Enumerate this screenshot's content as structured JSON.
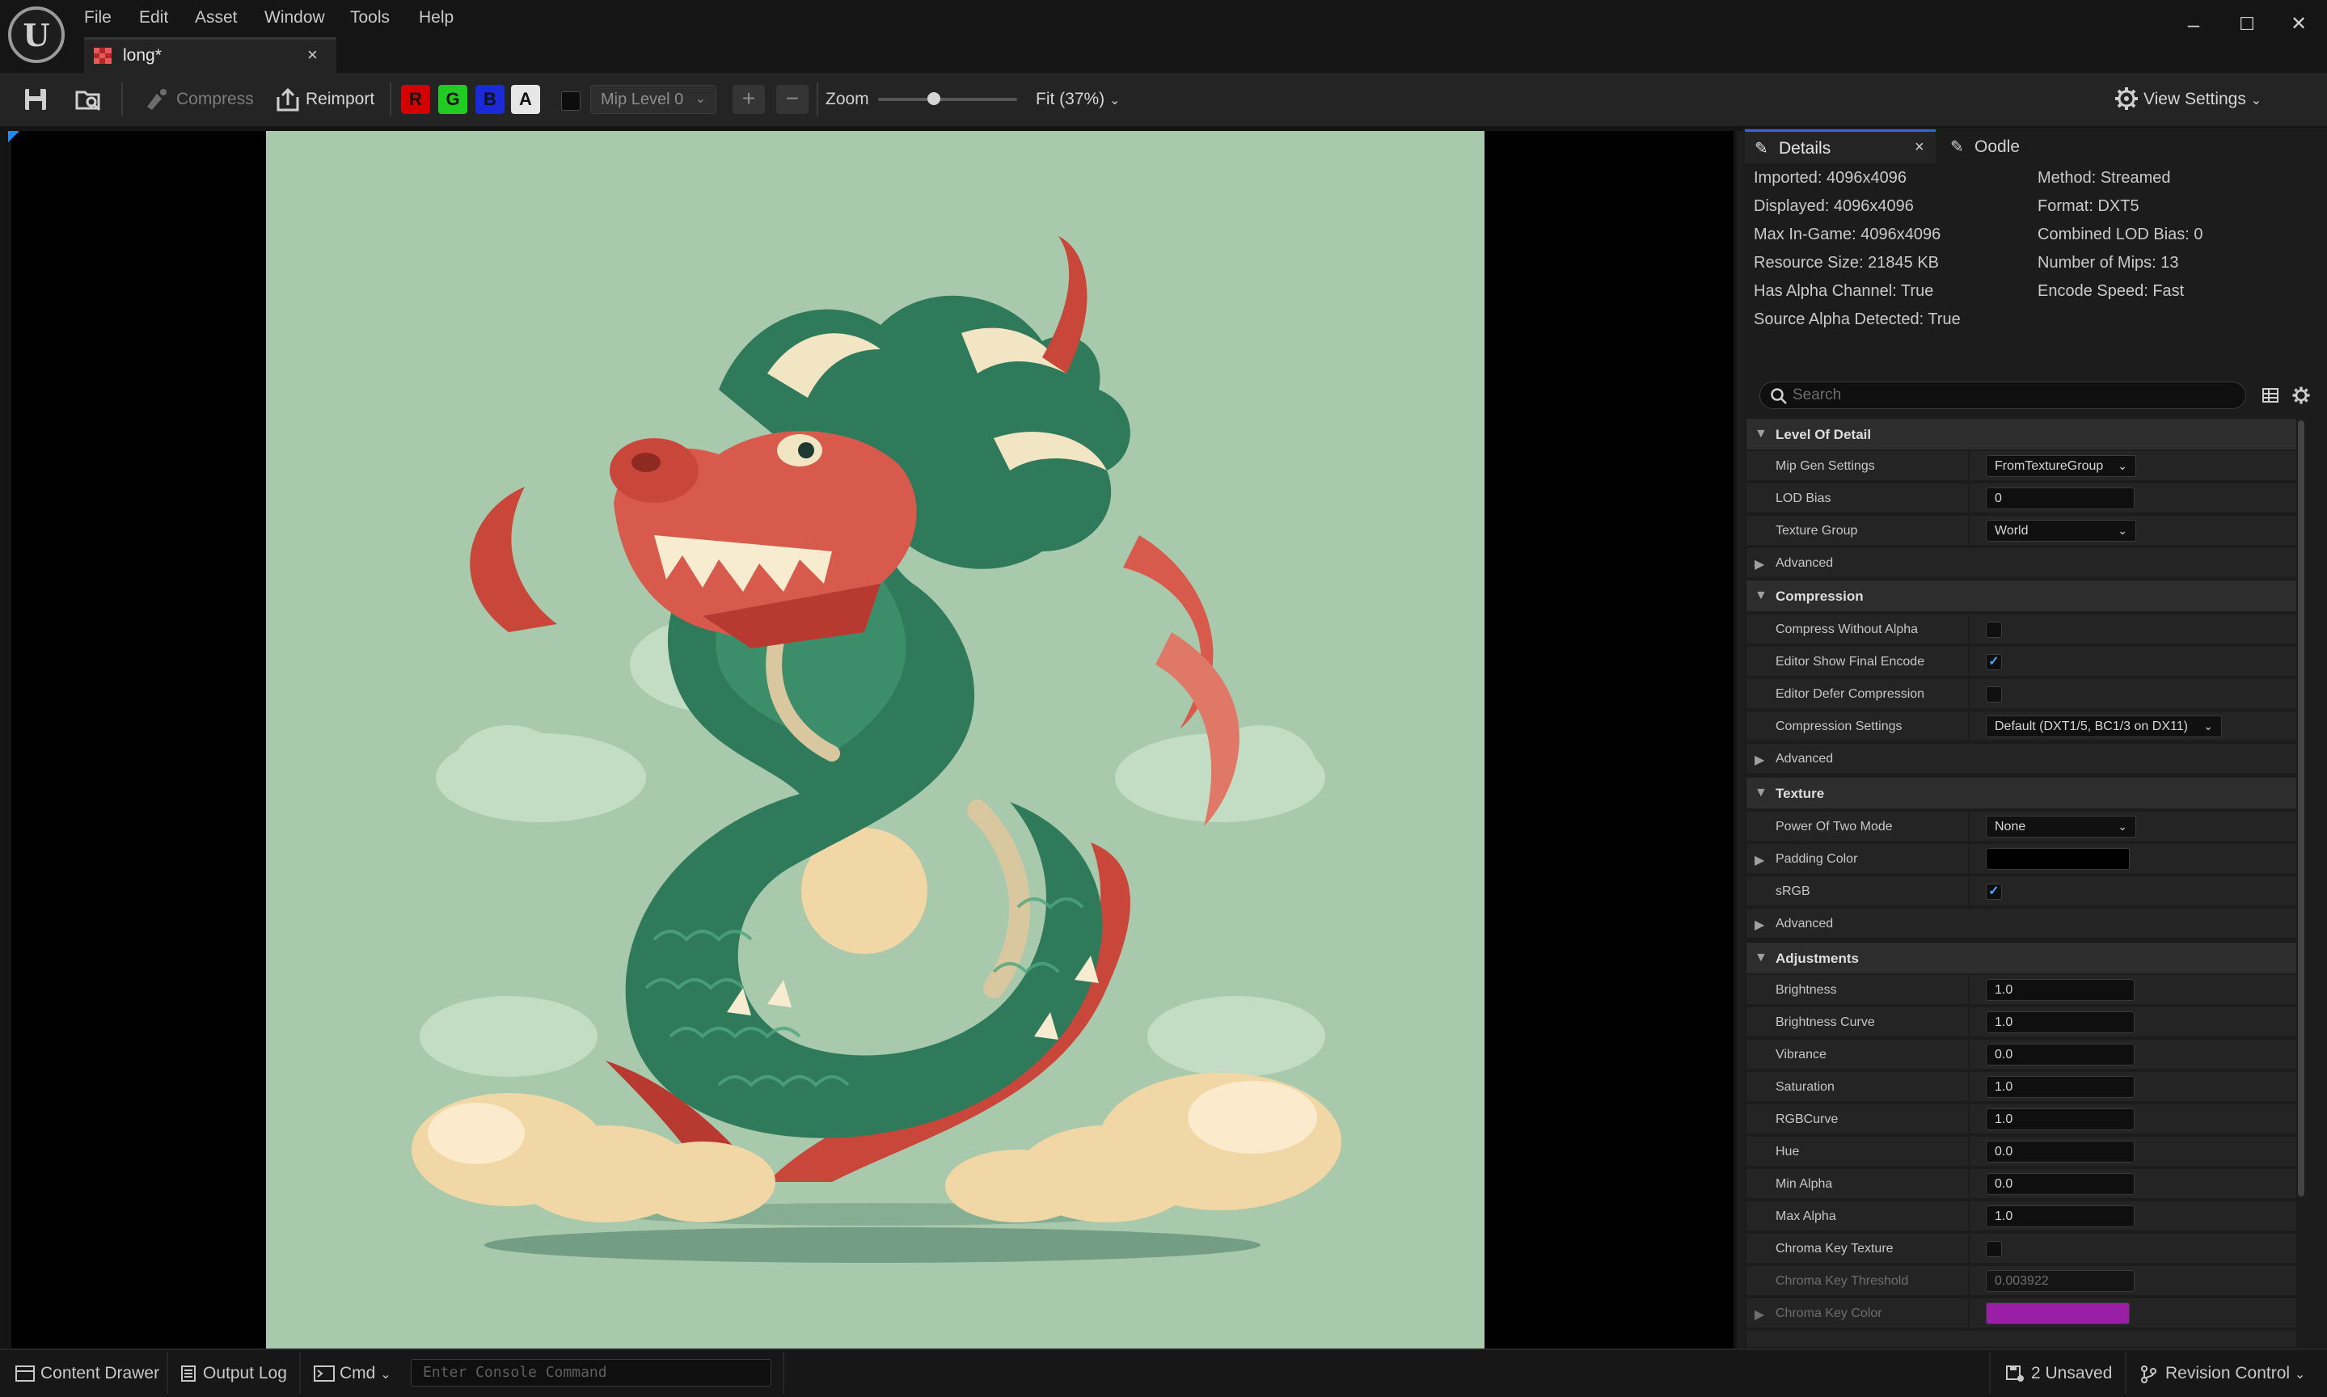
{
  "menu": [
    "File",
    "Edit",
    "Asset",
    "Window",
    "Tools",
    "Help"
  ],
  "tab": {
    "label": "long*",
    "close": "×"
  },
  "window_controls": {
    "minimize": "–",
    "maximize": "☐",
    "close": "✕"
  },
  "toolbar": {
    "compress": "Compress",
    "reimport": "Reimport",
    "channels": [
      {
        "label": "R",
        "bg": "#d40000",
        "fg": "#111111"
      },
      {
        "label": "G",
        "bg": "#1fcc1f",
        "fg": "#111111"
      },
      {
        "label": "B",
        "bg": "#1a2ad6",
        "fg": "#111111"
      },
      {
        "label": "A",
        "bg": "#e6e6e6",
        "fg": "#111111"
      }
    ],
    "mip_level": "Mip Level 0",
    "zoom_label": "Zoom",
    "zoom_value": "Fit (37%)",
    "zoom_slider_fraction": 0.4,
    "view_settings": "View Settings"
  },
  "details": {
    "tab_details": "Details",
    "tab_oodle": "Oodle",
    "stats_left": [
      "Imported: 4096x4096",
      "Displayed: 4096x4096",
      "Max In-Game: 4096x4096",
      "Resource Size: 21845 KB",
      "Has Alpha Channel: True",
      "Source Alpha Detected: True"
    ],
    "stats_right": [
      "Method: Streamed",
      "Format: DXT5",
      "Combined LOD Bias: 0",
      "Number of Mips: 13",
      "Encode Speed: Fast"
    ],
    "search_placeholder": "Search",
    "sections": {
      "lod": "Level Of Detail",
      "compression": "Compression",
      "texture": "Texture",
      "adjustments": "Adjustments"
    },
    "rows": {
      "mip_gen": {
        "label": "Mip Gen Settings",
        "value": "FromTextureGroup"
      },
      "lod_bias": {
        "label": "LOD Bias",
        "value": "0"
      },
      "texture_group": {
        "label": "Texture Group",
        "value": "World"
      },
      "advanced": "Advanced",
      "compress_without_alpha": {
        "label": "Compress Without Alpha",
        "checked": false
      },
      "editor_show_final_encode": {
        "label": "Editor Show Final Encode",
        "checked": true
      },
      "editor_defer_compression": {
        "label": "Editor Defer Compression",
        "checked": false
      },
      "compression_settings": {
        "label": "Compression Settings",
        "value": "Default (DXT1/5, BC1/3 on DX11)"
      },
      "power_of_two": {
        "label": "Power Of Two Mode",
        "value": "None"
      },
      "padding_color": {
        "label": "Padding Color",
        "color": "#000000"
      },
      "srgb": {
        "label": "sRGB",
        "checked": true
      },
      "brightness": {
        "label": "Brightness",
        "value": "1.0"
      },
      "brightness_curve": {
        "label": "Brightness Curve",
        "value": "1.0"
      },
      "vibrance": {
        "label": "Vibrance",
        "value": "0.0"
      },
      "saturation": {
        "label": "Saturation",
        "value": "1.0"
      },
      "rgbcurve": {
        "label": "RGBCurve",
        "value": "1.0"
      },
      "hue": {
        "label": "Hue",
        "value": "0.0"
      },
      "min_alpha": {
        "label": "Min Alpha",
        "value": "0.0"
      },
      "max_alpha": {
        "label": "Max Alpha",
        "value": "1.0"
      },
      "chroma_key_texture": {
        "label": "Chroma Key Texture",
        "checked": false
      },
      "chroma_key_threshold": {
        "label": "Chroma Key Threshold",
        "value": "0.003922"
      },
      "chroma_key_color": {
        "label": "Chroma Key Color",
        "color": "#9b1fa6"
      }
    }
  },
  "statusbar": {
    "content_drawer": "Content Drawer",
    "output_log": "Output Log",
    "cmd": "Cmd",
    "console_placeholder": "Enter Console Command",
    "unsaved": "2 Unsaved",
    "revision_control": "Revision Control"
  },
  "colors": {
    "accent": "#2e6be0",
    "texture_bg": "#a9c9ad",
    "dragon_green": "#2f7a5b",
    "dragon_red": "#c9473a",
    "cloud_cream": "#f2d7a6"
  }
}
